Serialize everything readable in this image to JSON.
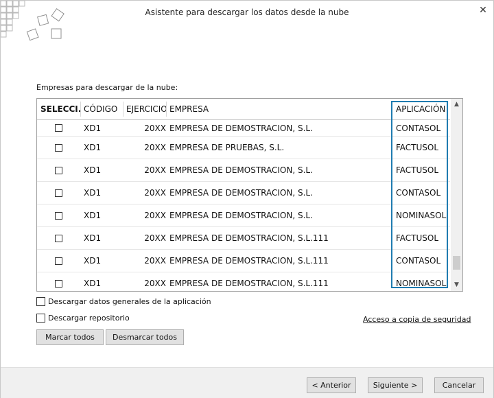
{
  "window": {
    "title": "Asistente para descargar los datos desde la nube",
    "close_glyph": "✕"
  },
  "section_label": "Empresas para descargar de la nube:",
  "table": {
    "columns": {
      "seleccion": "SELECCI...",
      "codigo": "CÓDIGO",
      "ejercicio": "EJERCICIO",
      "empresa": "EMPRESA",
      "aplicacion": "APLICACIÓN"
    },
    "rows": [
      {
        "checked": false,
        "codigo": "XD1",
        "ejercicio": "20XX",
        "empresa": "EMPRESA DE DEMOSTRACION, S.L.",
        "aplicacion": "CONTASOL"
      },
      {
        "checked": false,
        "codigo": "XD1",
        "ejercicio": "20XX",
        "empresa": "EMPRESA DE PRUEBAS, S.L.",
        "aplicacion": "FACTUSOL"
      },
      {
        "checked": false,
        "codigo": "XD1",
        "ejercicio": "20XX",
        "empresa": "EMPRESA DE DEMOSTRACION, S.L.",
        "aplicacion": "FACTUSOL"
      },
      {
        "checked": false,
        "codigo": "XD1",
        "ejercicio": "20XX",
        "empresa": "EMPRESA DE DEMOSTRACION, S.L.",
        "aplicacion": "CONTASOL"
      },
      {
        "checked": false,
        "codigo": "XD1",
        "ejercicio": "20XX",
        "empresa": "EMPRESA DE DEMOSTRACION, S.L.",
        "aplicacion": "NOMINASOL"
      },
      {
        "checked": false,
        "codigo": "XD1",
        "ejercicio": "20XX",
        "empresa": "EMPRESA DE DEMOSTRACION, S.L.111",
        "aplicacion": "FACTUSOL"
      },
      {
        "checked": false,
        "codigo": "XD1",
        "ejercicio": "20XX",
        "empresa": "EMPRESA DE DEMOSTRACION, S.L.111",
        "aplicacion": "CONTASOL"
      },
      {
        "checked": false,
        "codigo": "XD1",
        "ejercicio": "20XX",
        "empresa": "EMPRESA DE DEMOSTRACION, S.L.111",
        "aplicacion": "NOMINASOL"
      }
    ]
  },
  "options": {
    "download_general": {
      "label": "Descargar datos generales de la aplicación",
      "checked": false
    },
    "download_repo": {
      "label": "Descargar repositorio",
      "checked": false
    }
  },
  "backup_link": "Acceso a copia de seguridad",
  "buttons": {
    "mark_all": "Marcar todos",
    "unmark_all": "Desmarcar todos",
    "back": "< Anterior",
    "next": "Siguiente >",
    "cancel": "Cancelar"
  },
  "colors": {
    "highlight": "#1f7bb0"
  }
}
